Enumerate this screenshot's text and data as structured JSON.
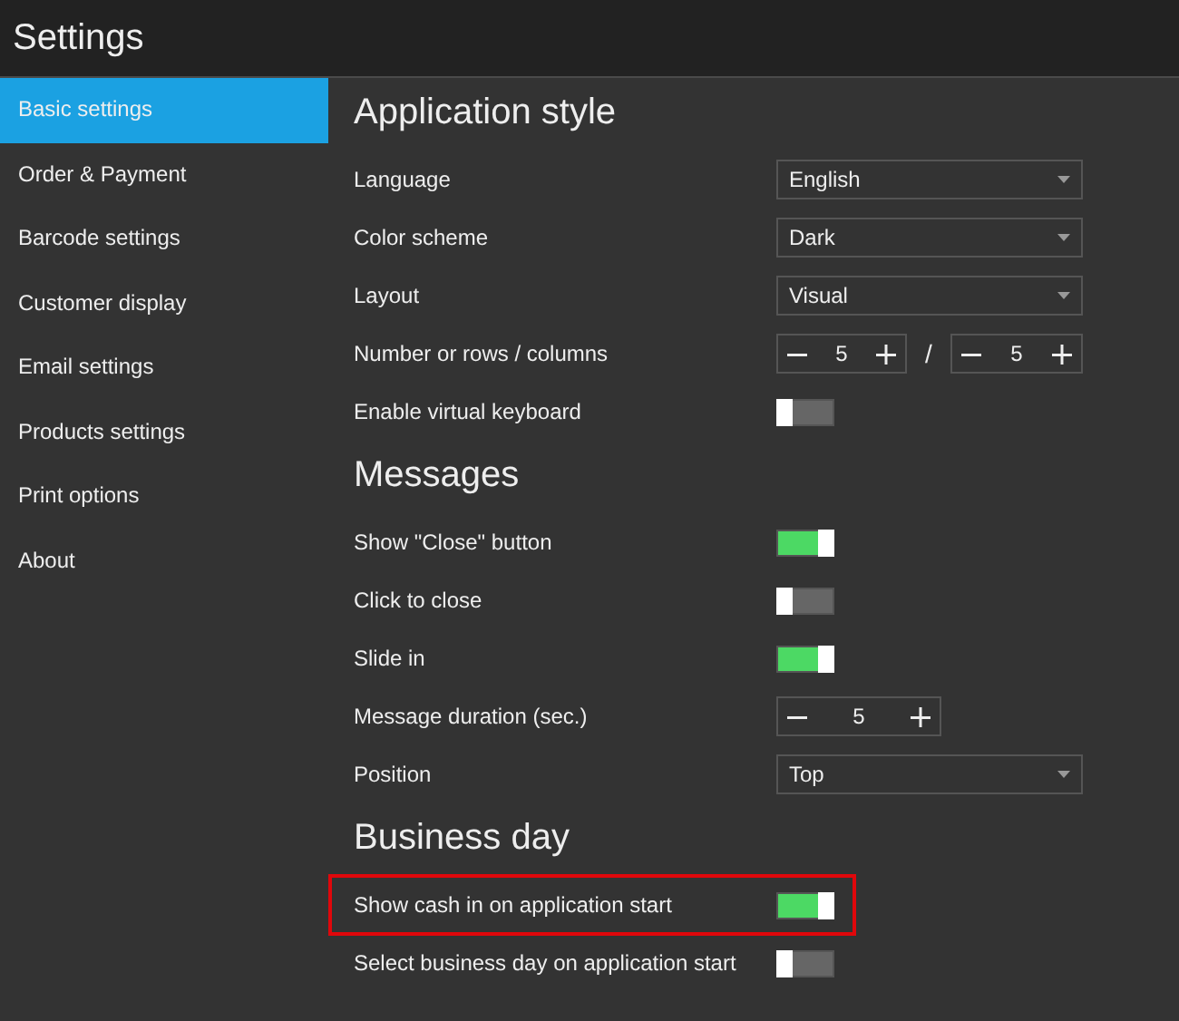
{
  "window": {
    "title": "Settings"
  },
  "sidebar": {
    "items": [
      {
        "label": "Basic settings",
        "selected": true
      },
      {
        "label": "Order & Payment",
        "selected": false
      },
      {
        "label": "Barcode settings",
        "selected": false
      },
      {
        "label": "Customer display",
        "selected": false
      },
      {
        "label": "Email settings",
        "selected": false
      },
      {
        "label": "Products settings",
        "selected": false
      },
      {
        "label": "Print options",
        "selected": false
      },
      {
        "label": "About",
        "selected": false
      }
    ]
  },
  "sections": [
    {
      "title": "Application style",
      "rows": [
        {
          "kind": "select",
          "label": "Language",
          "value": "English"
        },
        {
          "kind": "select",
          "label": "Color scheme",
          "value": "Dark"
        },
        {
          "kind": "select",
          "label": "Layout",
          "value": "Visual"
        },
        {
          "kind": "stepper_pair",
          "label": "Number or rows / columns",
          "values": [
            "5",
            "5"
          ],
          "separator": "/"
        },
        {
          "kind": "toggle",
          "label": "Enable virtual keyboard",
          "on": false
        }
      ]
    },
    {
      "title": "Messages",
      "rows": [
        {
          "kind": "toggle",
          "label": "Show \"Close\" button",
          "on": true
        },
        {
          "kind": "toggle",
          "label": "Click to close",
          "on": false
        },
        {
          "kind": "toggle",
          "label": "Slide in",
          "on": true
        },
        {
          "kind": "stepper",
          "label": "Message duration (sec.)",
          "value": "5"
        },
        {
          "kind": "select",
          "label": "Position",
          "value": "Top"
        }
      ]
    },
    {
      "title": "Business day",
      "rows": [
        {
          "kind": "toggle",
          "label": "Show cash in on application start",
          "on": true,
          "highlighted": true
        },
        {
          "kind": "toggle",
          "label": "Select business day on application start",
          "on": false,
          "highlighted": false
        }
      ]
    }
  ]
}
